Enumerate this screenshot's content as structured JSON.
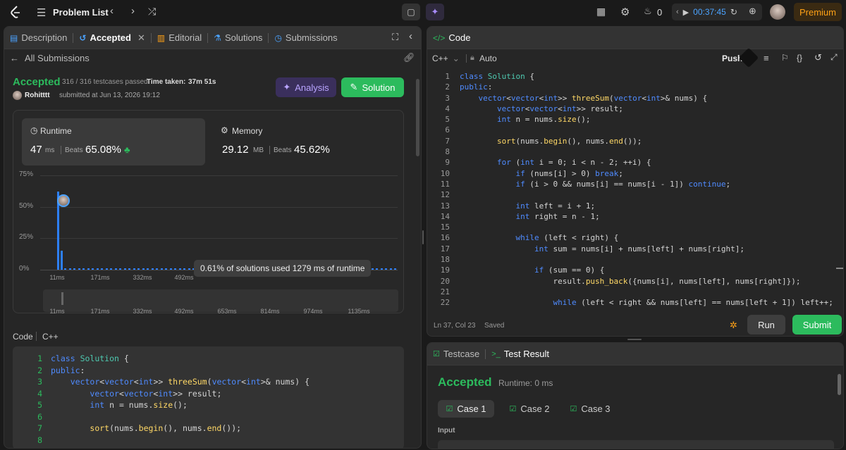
{
  "topbar": {
    "problem_list": "Problem List",
    "streak_count": "0",
    "timer": "00:37:45",
    "premium": "Premium"
  },
  "left_tabs": {
    "description": "Description",
    "accepted": "Accepted",
    "editorial": "Editorial",
    "solutions": "Solutions",
    "submissions": "Submissions"
  },
  "submission": {
    "back_label": "All Submissions",
    "status": "Accepted",
    "testcases": "316 / 316 testcases passed",
    "time_taken_label": "Time taken:",
    "time_taken": "37m 51s",
    "user": "Rohitttt",
    "submitted_at": "submitted at Jun 13, 2026 19:12",
    "analysis_btn": "Analysis",
    "solution_btn": "Solution"
  },
  "stats": {
    "runtime_label": "Runtime",
    "runtime_value": "47",
    "runtime_unit": "ms",
    "runtime_beats_label": "Beats",
    "runtime_beats": "65.08%",
    "memory_label": "Memory",
    "memory_value": "29.12",
    "memory_unit": "MB",
    "memory_beats_label": "Beats",
    "memory_beats": "45.62%"
  },
  "chart_data": {
    "type": "bar",
    "y_ticks": [
      "75%",
      "50%",
      "25%",
      "0%"
    ],
    "ylim": [
      0,
      75
    ],
    "x_ticks": [
      "11ms",
      "171ms",
      "332ms",
      "492ms"
    ],
    "x_ticks_mini": [
      "11ms",
      "171ms",
      "332ms",
      "492ms",
      "653ms",
      "814ms",
      "974ms",
      "1135ms"
    ],
    "bars_percent": [
      62,
      15,
      1,
      1,
      1,
      1,
      1,
      1,
      1,
      1,
      1,
      1,
      1,
      1,
      1,
      1,
      1,
      1,
      1,
      1,
      1,
      1,
      1,
      1,
      1,
      1,
      1,
      1,
      1,
      1,
      1,
      1,
      1,
      1,
      1,
      1,
      1,
      1,
      1,
      1,
      1,
      1,
      1,
      1,
      1,
      1,
      1,
      1,
      1,
      1,
      1,
      1,
      1,
      1,
      1,
      1,
      1,
      1,
      1,
      1,
      1,
      1,
      1,
      1,
      1,
      1,
      1,
      1,
      1,
      1,
      1,
      1,
      1,
      1,
      1
    ],
    "tooltip": "0.61% of solutions used 1279 ms of runtime",
    "grid": true
  },
  "code_section": {
    "label": "Code",
    "lang": "C++"
  },
  "left_code": [
    {
      "n": "1",
      "t": "class Solution {"
    },
    {
      "n": "2",
      "t": "public:"
    },
    {
      "n": "3",
      "t": "    vector<vector<int>> threeSum(vector<int>& nums) {"
    },
    {
      "n": "4",
      "t": "        vector<vector<int>> result;"
    },
    {
      "n": "5",
      "t": "        int n = nums.size();"
    },
    {
      "n": "6",
      "t": ""
    },
    {
      "n": "7",
      "t": "        sort(nums.begin(), nums.end());"
    },
    {
      "n": "8",
      "t": ""
    }
  ],
  "editor": {
    "title": "Code",
    "lang": "C++",
    "auto": "Auto",
    "push": "Push",
    "status_pos": "Ln 37, Col 23",
    "status_saved": "Saved",
    "run": "Run",
    "submit": "Submit"
  },
  "editor_code": [
    {
      "n": "1",
      "t": "class Solution {"
    },
    {
      "n": "2",
      "t": "public:"
    },
    {
      "n": "3",
      "t": "    vector<vector<int>> threeSum(vector<int>& nums) {"
    },
    {
      "n": "4",
      "t": "        vector<vector<int>> result;"
    },
    {
      "n": "5",
      "t": "        int n = nums.size();"
    },
    {
      "n": "6",
      "t": ""
    },
    {
      "n": "7",
      "t": "        sort(nums.begin(), nums.end());"
    },
    {
      "n": "8",
      "t": ""
    },
    {
      "n": "9",
      "t": "        for (int i = 0; i < n - 2; ++i) {"
    },
    {
      "n": "10",
      "t": "            if (nums[i] > 0) break;"
    },
    {
      "n": "11",
      "t": "            if (i > 0 && nums[i] == nums[i - 1]) continue;"
    },
    {
      "n": "12",
      "t": ""
    },
    {
      "n": "13",
      "t": "            int left = i + 1;"
    },
    {
      "n": "14",
      "t": "            int right = n - 1;"
    },
    {
      "n": "15",
      "t": ""
    },
    {
      "n": "16",
      "t": "            while (left < right) {"
    },
    {
      "n": "17",
      "t": "                int sum = nums[i] + nums[left] + nums[right];"
    },
    {
      "n": "18",
      "t": ""
    },
    {
      "n": "19",
      "t": "                if (sum == 0) {"
    },
    {
      "n": "20",
      "t": "                    result.push_back({nums[i], nums[left], nums[right]});"
    },
    {
      "n": "21",
      "t": ""
    },
    {
      "n": "22",
      "t": "                    while (left < right && nums[left] == nums[left + 1]) left++;"
    }
  ],
  "result_panel": {
    "testcase_tab": "Testcase",
    "result_tab": "Test Result",
    "status": "Accepted",
    "runtime": "Runtime: 0 ms",
    "case1": "Case 1",
    "case2": "Case 2",
    "case3": "Case 3",
    "input_label": "Input"
  },
  "colors": {
    "accent_green": "#2cbb5d",
    "accent_orange": "#ffa116",
    "bar_blue": "#2d7ff9"
  }
}
